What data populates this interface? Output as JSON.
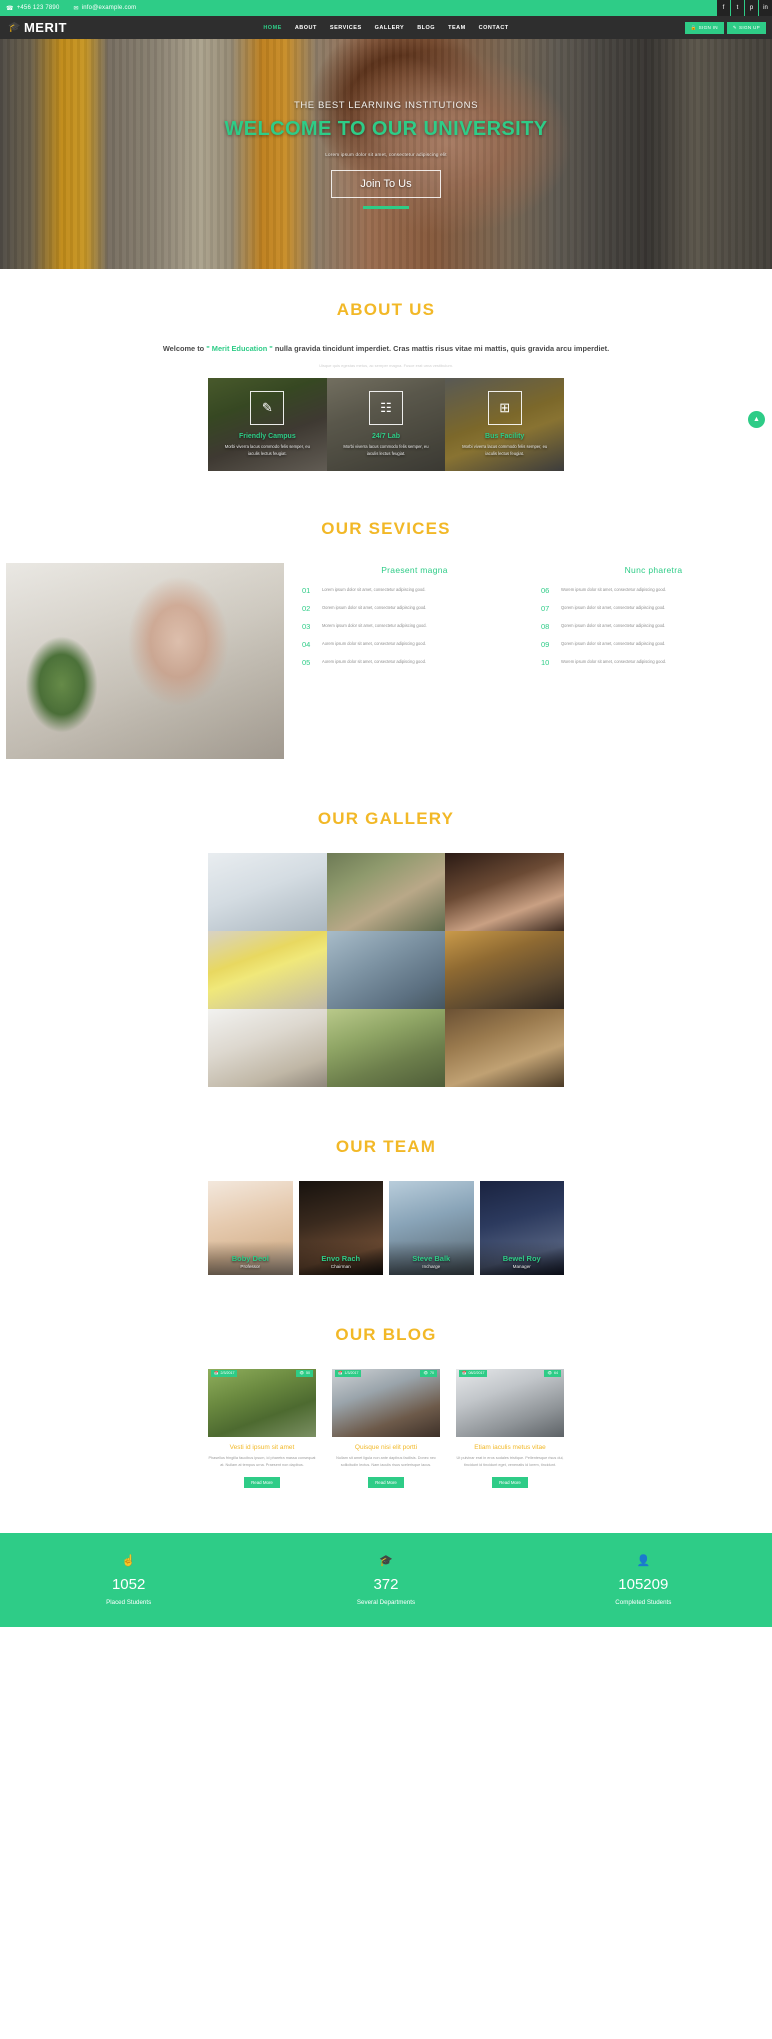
{
  "topbar": {
    "phone": "+456 123 7890",
    "email": "info@example.com",
    "phone_icon": "phone-icon",
    "email_icon": "envelope-icon",
    "socials": [
      {
        "name": "facebook-icon",
        "glyph": "f"
      },
      {
        "name": "twitter-icon",
        "glyph": "t"
      },
      {
        "name": "pinterest-icon",
        "glyph": "p"
      },
      {
        "name": "linkedin-icon",
        "glyph": "in"
      }
    ]
  },
  "nav": {
    "brand": "MERIT",
    "brand_icon": "graduation-cap-icon",
    "links": [
      {
        "label": "HOME",
        "active": true
      },
      {
        "label": "ABOUT",
        "active": false
      },
      {
        "label": "SERVICES",
        "active": false
      },
      {
        "label": "GALLERY",
        "active": false
      },
      {
        "label": "BLOG",
        "active": false
      },
      {
        "label": "TEAM",
        "active": false
      },
      {
        "label": "CONTACT",
        "active": false
      }
    ],
    "sign_in": "SIGN IN",
    "sign_up": "SIGN UP"
  },
  "hero": {
    "kicker": "THE BEST LEARNING INSTITUTIONS",
    "title": "WELCOME TO OUR UNIVERSITY",
    "subtitle": "Lorem ipsum dolor sit amet, consectetur adipiscing elit",
    "button": "Join To Us"
  },
  "about": {
    "title": "ABOUT US",
    "lead_pre": "Welcome to ",
    "lead_highlight": "\" Merit Education \"",
    "lead_post": " nulla gravida tincidunt imperdiet. Cras mattis risus vitae mi mattis, quis gravida arcu imperdiet.",
    "note": "Uisque quis egestas metus, ac semper magna. Fusce erat urna vestibulum.",
    "features": [
      {
        "title": "Friendly Campus",
        "desc": "Morbi viverra lacus commodo felis semper, eu iaculis lectus feugiat.",
        "icon": "pencil-icon",
        "glyph": "✎"
      },
      {
        "title": "24/7 Lab",
        "desc": "Morbi viverra lacus commodo felis semper, eu iaculis lectus feugiat.",
        "icon": "book-icon",
        "glyph": "☷"
      },
      {
        "title": "Bus Facility",
        "desc": "Morbi viverra lacus commodo felis semper, eu iaculis lectus feugiat.",
        "icon": "bus-icon",
        "glyph": "⊞"
      }
    ]
  },
  "services": {
    "title": "OUR SEVICES",
    "columns": [
      {
        "heading": "Praesent magna",
        "items": [
          {
            "num": "01",
            "text": "Lorem ipsum dolor sit amet, consectetur adipiscing good."
          },
          {
            "num": "02",
            "text": "Oorem ipsum dolor sit amet, consectetur adipiscing good."
          },
          {
            "num": "03",
            "text": "Morem ipsum dolor sit amet, consectetur adipiscing good."
          },
          {
            "num": "04",
            "text": "Aorem ipsum dolor sit amet, consectetur adipiscing good."
          },
          {
            "num": "05",
            "text": "Aorem ipsum dolor sit amet, consectetur adipiscing good."
          }
        ]
      },
      {
        "heading": "Nunc pharetra",
        "items": [
          {
            "num": "06",
            "text": "Worem ipsum dolor sit amet, consectetur adipiscing good."
          },
          {
            "num": "07",
            "text": "Qorem ipsum dolor sit amet, consectetur adipiscing good."
          },
          {
            "num": "08",
            "text": "Qorem ipsum dolor sit amet, consectetur adipiscing good."
          },
          {
            "num": "09",
            "text": "Qorem ipsum dolor sit amet, consectetur adipiscing good."
          },
          {
            "num": "10",
            "text": "Worem ipsum dolor sit amet, consectetur adipiscing good."
          }
        ]
      }
    ]
  },
  "gallery": {
    "title": "OUR GALLERY",
    "items": [
      {
        "name": "gallery-item-1"
      },
      {
        "name": "gallery-item-2"
      },
      {
        "name": "gallery-item-3"
      },
      {
        "name": "gallery-item-4"
      },
      {
        "name": "gallery-item-5"
      },
      {
        "name": "gallery-item-6"
      },
      {
        "name": "gallery-item-7"
      },
      {
        "name": "gallery-item-8"
      },
      {
        "name": "gallery-item-9"
      }
    ]
  },
  "team": {
    "title": "OUR TEAM",
    "members": [
      {
        "name": "Boby Deol",
        "role": "Professor"
      },
      {
        "name": "Envo Rach",
        "role": "Chairman"
      },
      {
        "name": "Steve Balk",
        "role": "Incharge"
      },
      {
        "name": "Bewel Roy",
        "role": "Manager"
      }
    ]
  },
  "blog": {
    "title": "OUR BLOG",
    "posts": [
      {
        "date": "2/3/2017",
        "views": "50",
        "title": "Vesti id ipsum sit amet",
        "desc": "Phasellus fringilla faucibus ipsum, id pharetra massa consequat at. Nullam at tempus urna. Praesent non dapibus.",
        "button": "Read More"
      },
      {
        "date": "1/3/2017",
        "views": "70",
        "title": "Quisque nisi elit portti",
        "desc": "Nullam sit amet ligula non ante dapibus facilisis. Donec nec sollicitudin lectus. Nam iaculis risus scelerisque lacus.",
        "button": "Read More"
      },
      {
        "date": "08/2/2017",
        "views": "64",
        "title": "Etiam iaculis metus vitae",
        "desc": "Ut pulvinar erat in eros sodales tristique. Pellentesque risus dui, tincidunt id tincidunt eget, venenatis id lorem, tincidunt.",
        "button": "Read More"
      }
    ],
    "date_icon": "calendar-icon",
    "views_icon": "eye-icon"
  },
  "counters": [
    {
      "icon": "hand-icon",
      "glyph": "☝",
      "number": "1052",
      "label": "Placed Students"
    },
    {
      "icon": "graduation-cap-icon",
      "glyph": "🎓",
      "number": "372",
      "label": "Several Departments"
    },
    {
      "icon": "user-icon",
      "glyph": "👤",
      "number": "105209",
      "label": "Completed Students"
    }
  ],
  "scroll_top": {
    "icon": "chevron-up-icon",
    "glyph": "▲"
  },
  "colors": {
    "green": "#2ecc87",
    "gold": "#f2b827",
    "dark": "#2e2e2e"
  }
}
